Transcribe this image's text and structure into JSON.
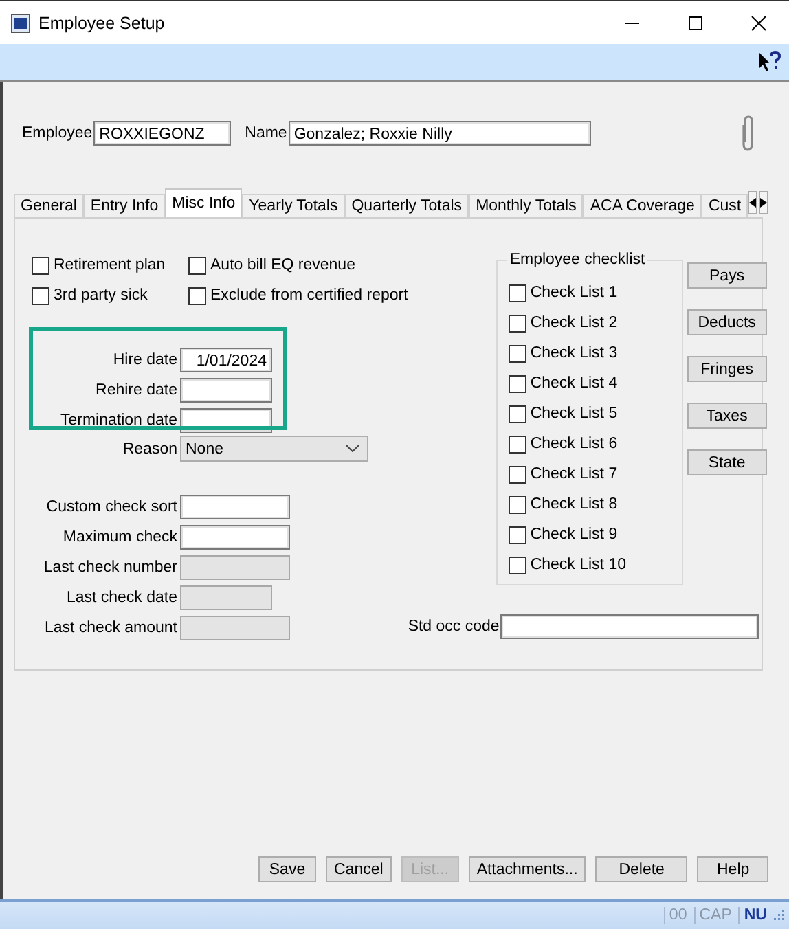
{
  "window": {
    "title": "Employee Setup"
  },
  "employee": {
    "label": "Employee",
    "value": "ROXXIEGONZ"
  },
  "name": {
    "label": "Name",
    "value": "Gonzalez; Roxxie Nilly"
  },
  "tabs": [
    {
      "label": "General",
      "selected": false
    },
    {
      "label": "Entry Info",
      "selected": false
    },
    {
      "label": "Misc Info",
      "selected": true
    },
    {
      "label": "Yearly Totals",
      "selected": false
    },
    {
      "label": "Quarterly Totals",
      "selected": false
    },
    {
      "label": "Monthly Totals",
      "selected": false
    },
    {
      "label": "ACA Coverage",
      "selected": false
    },
    {
      "label": "Cust",
      "selected": false
    }
  ],
  "options": [
    {
      "label": "Retirement plan",
      "checked": false
    },
    {
      "label": "Auto bill EQ revenue",
      "checked": false
    },
    {
      "label": "3rd party sick",
      "checked": false
    },
    {
      "label": "Exclude from certified report",
      "checked": false
    }
  ],
  "dates": [
    {
      "label": "Hire date",
      "value": "1/01/2024"
    },
    {
      "label": "Rehire date"
    },
    {
      "label": "Termination date"
    }
  ],
  "reason": {
    "label": "Reason",
    "value": "None"
  },
  "checks": [
    {
      "label": "Custom check sort",
      "kind": "wide",
      "disabled": false
    },
    {
      "label": "Maximum check",
      "kind": "wide",
      "disabled": false
    },
    {
      "label": "Last check number",
      "kind": "wide",
      "disabled": true
    },
    {
      "label": "Last check date",
      "kind": "date",
      "disabled": true
    },
    {
      "label": "Last check amount",
      "kind": "wide",
      "disabled": true
    }
  ],
  "checklist": {
    "title": "Employee checklist",
    "items": [
      {
        "label": "Check List 1",
        "checked": false
      },
      {
        "label": "Check List 2",
        "checked": false
      },
      {
        "label": "Check List 3",
        "checked": false
      },
      {
        "label": "Check List 4",
        "checked": false
      },
      {
        "label": "Check List 5",
        "checked": false
      },
      {
        "label": "Check List 6",
        "checked": false
      },
      {
        "label": "Check List 7",
        "checked": false
      },
      {
        "label": "Check List 8",
        "checked": false
      },
      {
        "label": "Check List 9",
        "checked": false
      },
      {
        "label": "Check List 10",
        "checked": false
      }
    ]
  },
  "side_buttons": [
    "Pays",
    "Deducts",
    "Fringes",
    "Taxes",
    "State"
  ],
  "std_occ_code": {
    "label": "Std occ code"
  },
  "buttons": [
    {
      "label": "Save",
      "disabled": false
    },
    {
      "label": "Cancel",
      "disabled": false
    },
    {
      "label": "List...",
      "disabled": true
    },
    {
      "label": "Attachments...",
      "disabled": false
    },
    {
      "label": "Delete",
      "disabled": false
    },
    {
      "label": "Help",
      "disabled": false
    }
  ],
  "status_bar": [
    {
      "label": "00",
      "on": false
    },
    {
      "label": "CAP",
      "on": false
    },
    {
      "label": "NU",
      "on": true
    }
  ]
}
